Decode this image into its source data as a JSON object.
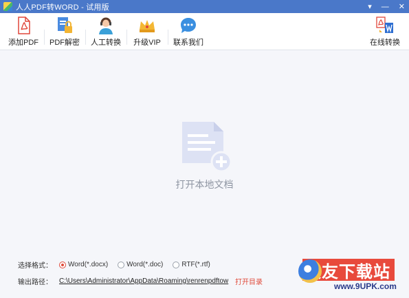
{
  "window": {
    "title": "人人PDF转WORD - 试用版",
    "minimize_glyph": "▾",
    "min_glyph": "—",
    "close_glyph": "✕"
  },
  "toolbar": {
    "items": [
      {
        "label": "添加PDF",
        "icon": "pdf-file-icon"
      },
      {
        "label": "PDF解密",
        "icon": "doc-lock-icon"
      },
      {
        "label": "人工转换",
        "icon": "support-agent-icon"
      },
      {
        "label": "升级VIP",
        "icon": "crown-icon"
      },
      {
        "label": "联系我们",
        "icon": "chat-bubble-icon"
      }
    ],
    "online": {
      "label": "在线转换",
      "icon": "pdf-to-word-icon"
    }
  },
  "main": {
    "open_local": "打开本地文档",
    "icon": "document-add-icon"
  },
  "bottom": {
    "format_label": "选择格式：",
    "formats": [
      {
        "label": "Word(*.docx)",
        "checked": true
      },
      {
        "label": "Word(*.doc)",
        "checked": false
      },
      {
        "label": "RTF(*.rtf)",
        "checked": false
      }
    ],
    "output_label": "输出路径：",
    "output_path": "C:\\Users\\Administrator\\AppData\\Roaming\\renrenpdftow",
    "open_dir": "打开目录"
  },
  "watermark": {
    "text": "久友下载站",
    "url": "www.9UPK.com"
  },
  "colors": {
    "titlebar": "#4a78c9",
    "accent": "#e04a3a",
    "doc_icon": "#dde2f4"
  }
}
